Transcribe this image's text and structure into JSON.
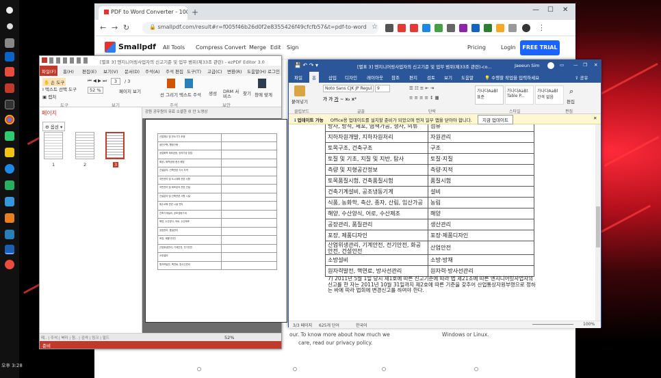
{
  "taskbar": {
    "clock": "오후 3:28"
  },
  "chrome": {
    "tab_title": "PDF to Word Converter - 100% Free",
    "url": "smallpdf.com/result#r=f005f46b26d0f2e8355426f49cfcfb57&t=pdf-to-word",
    "brand": "Smallpdf",
    "nav": [
      "All Tools",
      "Compress",
      "Convert",
      "Merge",
      "Edit",
      "Sign"
    ],
    "pricing": "Pricing",
    "login": "Login",
    "free_trial": "FREE TRIAL",
    "footer_left_1": "our. To know more about how much we",
    "footer_left_2": "care, read our privacy policy.",
    "footer_right": "Windows or Linux."
  },
  "pdf": {
    "title": "[별표 3] 엔지니어링사업자의 신고기준 및 업무 범위(제33조 관련) - ezPDF Editor 3.0",
    "menu": [
      "파일(F)",
      "홈(H)",
      "편집(E)",
      "보기(V)",
      "문서(D)",
      "주석(A)",
      "주석 편집",
      "도구(T)",
      "고급(C)",
      "변환(R)",
      "도움말(H)",
      "로그인"
    ],
    "tools": {
      "hand": "손 도구",
      "text_select": "텍스트 선택 도구",
      "snapshot": "캡처",
      "signature": "선 그리기",
      "text_edit": "텍스트 주석",
      "link": "생성",
      "drm": "DRM 서비스",
      "find": "찾기",
      "zoom": "52 %",
      "page_of": "/ 3",
      "view": "페이지 보기",
      "fit": "전체 보기",
      "group_tools": "도구",
      "group_view": "보기",
      "group_annot": "주석",
      "group_sec": "보안",
      "search_sec": "찾기",
      "jump": "창에 맞게"
    },
    "panel_title": "페이지",
    "options": "옵션",
    "thumbs": [
      "1",
      "2",
      "3"
    ],
    "viewer_header": "강원 공무원의 유료 소셜한 쉬 안 노영상",
    "status_zoom": "52%",
    "bottom_left": "준비",
    "page_rows": [
      "산업체수 및 연소기기 조정",
      "공단구축, 행정구축",
      "공업화학 제조공정, 양곡가공 창업",
      "화공 / 화학공정 종사 해당",
      "건설분야, 건축관련 기사 자격",
      "지반관리 및 도시계획 관련 사항",
      "지반관리 및 제조분야 관련 건설",
      "건설분야 및 건축관련 사항 시설",
      "특수교육 관련 시설 관리",
      "건축기계설비, 공조냉동기계",
      "해양, 수산양식, 어로, 수산제조",
      "공장관리, 품질관리",
      "포장, 제품디자인",
      "산업위생관리, 기계안전, 전기안전",
      "소방설비",
      "원자력발전, 핵연료, 방사선관리"
    ]
  },
  "word": {
    "title": "[별표 3] 엔지니어링사업자의 신고기준 및 업무 범위(제33조 관련)-co...",
    "user": "Jaeeun Sim",
    "tabs": [
      "파일",
      "홈",
      "삽입",
      "디자인",
      "레이아웃",
      "참조",
      "편지",
      "검토",
      "보기",
      "도움말",
      "수행할 작업을 입력하세요"
    ],
    "share": "공유",
    "font": "Noto Sans CJK JP Regul",
    "size": "9",
    "styles": [
      "가나다AaBl 표준",
      "가나다AaBl Table P...",
      "가나다AaBl 간격 없음"
    ],
    "groups": [
      "클립보드",
      "글꼴",
      "단락",
      "스타일",
      "편집"
    ],
    "paste": "붙여넣기",
    "editing": "편집",
    "notice_label": "업데이트 가능",
    "notice": "Office용 업데이트를 설치할 준비가 되었으며 먼저 일부 앱을 닫아야 합니다.",
    "notice_btn": "지금 업데이트",
    "rows": [
      [
        "방사, 방적, 제포, 염색가공, 생사, 의류",
        "섬유"
      ],
      [
        "지하자원개발, 지하자원처리",
        "자원관리"
      ],
      [
        "토목구조, 건축구조",
        "구조"
      ],
      [
        "토질 및 기초, 지질 및 지반, 탐사",
        "토질·지질"
      ],
      [
        "측량 및 지형공간정보",
        "측량·지적"
      ],
      [
        "토목품질시험, 건축품질시험",
        "품질시험"
      ],
      [
        "건축기계설비, 공조냉동기계",
        "설비"
      ],
      [
        "식품, 농화학, 축산, 종자, 산림, 임산가공",
        "농림"
      ],
      [
        "해양, 수산양식, 어로, 수산제조",
        "해양"
      ],
      [
        "공장관리, 품질관리",
        "생산관리"
      ],
      [
        "포장, 제품디자인",
        "포장·제품디자인"
      ],
      [
        "산업위생관리, 기계안전, 전기안전, 화공안전, 건설안전",
        "산업안전"
      ],
      [
        "소방설비",
        "소방·방재"
      ],
      [
        "원자력발전, 핵연료, 방사선관리",
        "원자력·방사선관리"
      ]
    ],
    "note": "7) 2011년 5월 1일 당시 제1호에 따른 신고기준에 따라 법 제21조에 따른 엔지니어링사업자의 신고를 한 자는 2011년 10월 31일까지 제2호에 따른 기준을 갖추어 산업통상자원부령으로 정하는 바에 따라 법회에 변경신고를 하여야 한다.",
    "status_page": "3/3 페이지",
    "status_words": "625개 단어",
    "status_lang": "한국어",
    "status_zoom": "100%"
  }
}
